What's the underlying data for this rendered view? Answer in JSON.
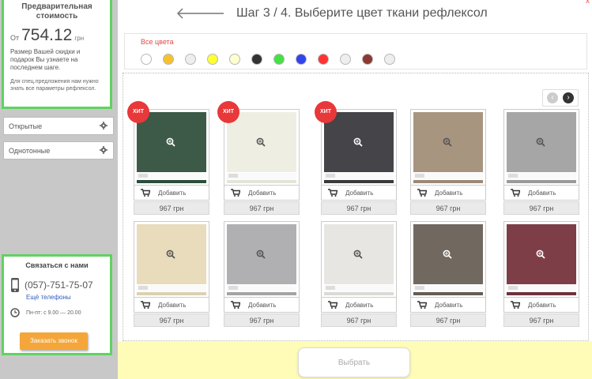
{
  "sidebar": {
    "price": {
      "title_line1": "Предварительная",
      "title_line2": "стоимость",
      "from": "От",
      "value": "754.12",
      "currency": "грн",
      "note": "Размер Вашей скидки и подарок Вы узнаете на последнем шаге.",
      "note2": "Для спец.предложения нам нужно знать все параметры рефлексол."
    },
    "filters": [
      {
        "label": "Открытые"
      },
      {
        "label": "Однотонные"
      }
    ],
    "contact": {
      "title": "Связаться с нами",
      "phone": "(057)-751-75-07",
      "more_phones": "Ещё телефоны",
      "hours": "Пн-пт: с 9.00 — 20.00",
      "call_button": "Заказать звонок"
    }
  },
  "header": {
    "close": "x",
    "title": "Шаг 3 / 4. Выберите цвет ткани рефлексол"
  },
  "colors": {
    "label": "Все цвета",
    "swatches": [
      "#ffffff",
      "#f5c12e",
      "#eeeeee",
      "#ffff33",
      "#ffffd0",
      "#333333",
      "#44e044",
      "#3344ee",
      "#ff3333",
      "#eeeeee",
      "#8b3a32",
      "#eeeeee"
    ]
  },
  "products": [
    {
      "badge": "ХИТ",
      "add_label": "Добавить",
      "price": "967 грн",
      "fabric": "#3d5a48",
      "edge": "#2b4d3c"
    },
    {
      "badge": "ХИТ",
      "add_label": "Добавить",
      "price": "967 грн",
      "fabric": "#efeee2",
      "edge": "#e4e4d8"
    },
    {
      "badge": "ХИТ",
      "add_label": "Добавить",
      "price": "967 грн",
      "fabric": "#454448",
      "edge": "#3a3a3c"
    },
    {
      "badge": "",
      "add_label": "Добавить",
      "price": "967 грн",
      "fabric": "#a89580",
      "edge": "#9c8a76"
    },
    {
      "badge": "",
      "add_label": "Добавить",
      "price": "967 грн",
      "fabric": "#a6a6a6",
      "edge": "#9a9a9a"
    },
    {
      "badge": "",
      "add_label": "Добавить",
      "price": "967 грн",
      "fabric": "#e8dcbc",
      "edge": "#ddd0b0"
    },
    {
      "badge": "",
      "add_label": "Добавить",
      "price": "967 грн",
      "fabric": "#b0b0b2",
      "edge": "#a4a4a6"
    },
    {
      "badge": "",
      "add_label": "Добавить",
      "price": "967 грн",
      "fabric": "#e8e6e2",
      "edge": "#dcdad6"
    },
    {
      "badge": "",
      "add_label": "Добавить",
      "price": "967 грн",
      "fabric": "#716860",
      "edge": "#655c54"
    },
    {
      "badge": "",
      "add_label": "Добавить",
      "price": "967 грн",
      "fabric": "#7e3e48",
      "edge": "#6e323c"
    }
  ],
  "footer": {
    "select_button": "Выбрать"
  }
}
